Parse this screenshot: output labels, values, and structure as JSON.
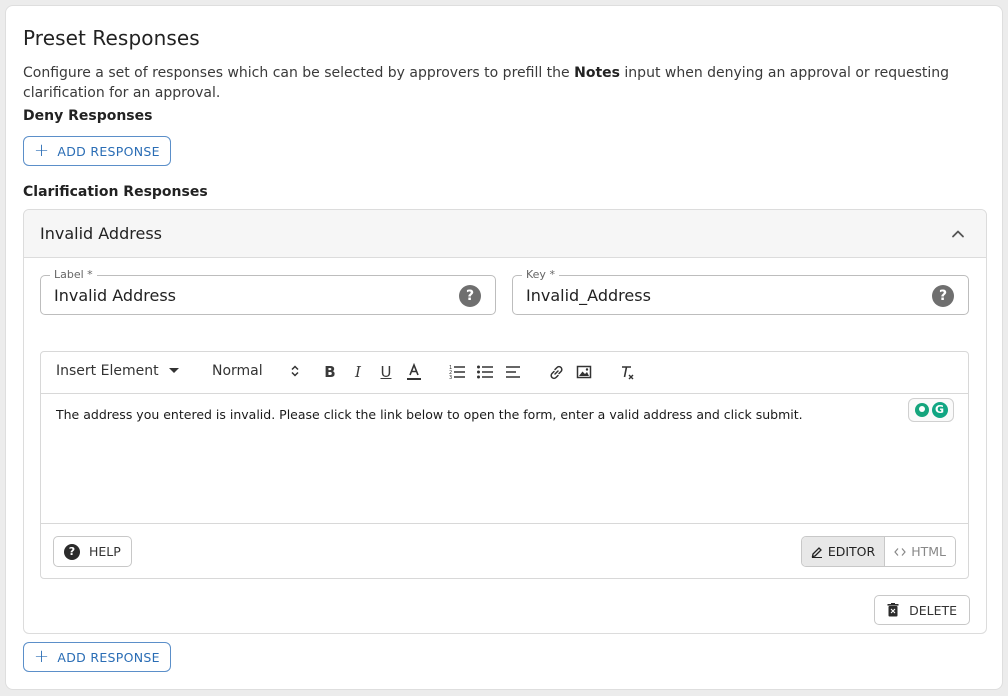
{
  "header": {
    "title": "Preset Responses",
    "description_before": "Configure a set of responses which can be selected by approvers to prefill the ",
    "description_bold": "Notes",
    "description_after": " input when denying an approval or requesting clarification for an approval."
  },
  "deny": {
    "label": "Deny Responses",
    "add_label": "ADD RESPONSE"
  },
  "clarification": {
    "label": "Clarification Responses",
    "add_label": "ADD RESPONSE",
    "items": [
      {
        "title": "Invalid Address",
        "label_field": {
          "label": "Label *",
          "value": "Invalid Address"
        },
        "key_field": {
          "label": "Key *",
          "value": "Invalid_Address"
        },
        "editor": {
          "insert_element": "Insert Element",
          "text_style": "Normal",
          "content": "The address you entered is invalid. Please click the link below to open the form, enter a valid address and click submit.",
          "help_label": "HELP",
          "mode_editor": "EDITOR",
          "mode_html": "HTML",
          "active_mode": "EDITOR"
        },
        "delete_label": "DELETE"
      }
    ]
  },
  "icons": {
    "help": "?",
    "grammarly": "G"
  },
  "colors": {
    "accent": "#2a6db5",
    "grammarly": "#11a683"
  }
}
